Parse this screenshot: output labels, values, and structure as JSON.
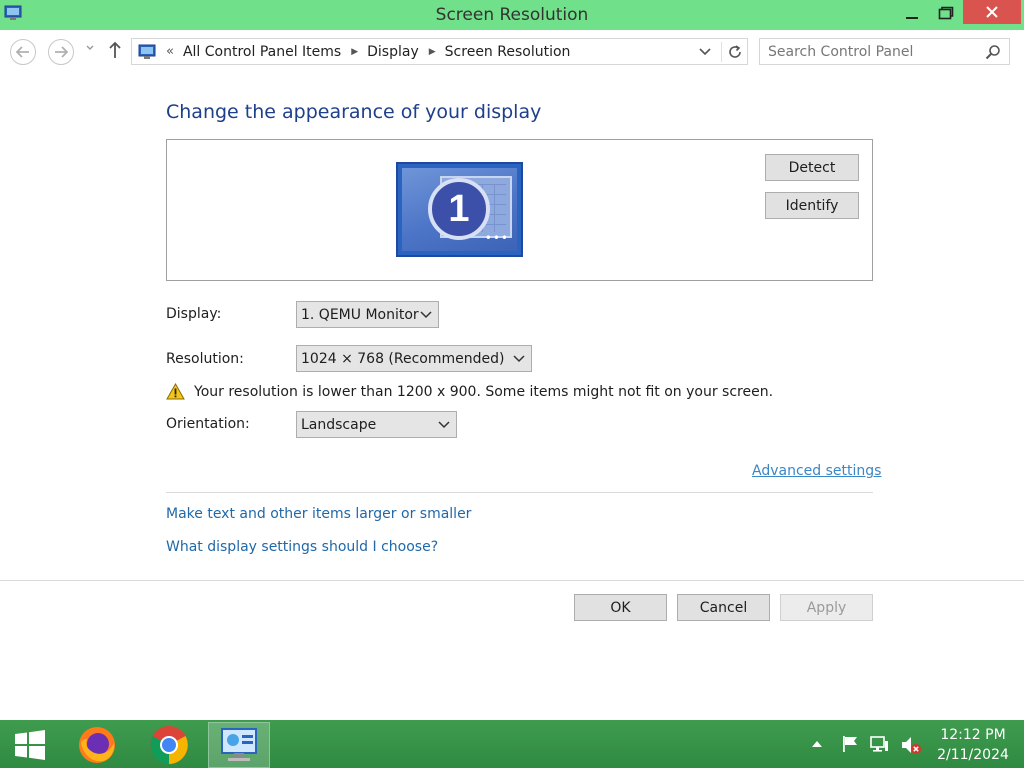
{
  "window": {
    "title": "Screen Resolution"
  },
  "address_bar": {
    "overflow": "«",
    "breadcrumbs": [
      "All Control Panel Items",
      "Display",
      "Screen Resolution"
    ],
    "search_placeholder": "Search Control Panel"
  },
  "main": {
    "heading": "Change the appearance of your display",
    "monitor_number": "1",
    "monitor_dots": "•••",
    "detect_label": "Detect",
    "identify_label": "Identify",
    "display_label": "Display:",
    "display_value": "1. QEMU Monitor",
    "resolution_label": "Resolution:",
    "resolution_value": "1024 × 768 (Recommended)",
    "warning_text": "Your resolution is lower than 1200 x 900. Some items might not fit on your screen.",
    "orientation_label": "Orientation:",
    "orientation_value": "Landscape",
    "advanced_link": "Advanced settings",
    "text_size_link": "Make text and other items larger or smaller",
    "help_link": "What display settings should I choose?"
  },
  "footer": {
    "ok_label": "OK",
    "cancel_label": "Cancel",
    "apply_label": "Apply"
  },
  "taskbar": {
    "time": "12:12 PM",
    "date": "2/11/2024"
  },
  "colors": {
    "titlebar": "#70e08a",
    "close_button": "#d9534f",
    "heading": "#1e3f8c",
    "link": "#2168a8",
    "taskbar": "#2f8a42"
  },
  "icons": [
    "control-panel-icon",
    "minimize-icon",
    "maximize-icon",
    "close-icon",
    "back-icon",
    "forward-icon",
    "recent-dropdown-icon",
    "up-icon",
    "chevron-down-icon",
    "refresh-icon",
    "search-icon",
    "warning-icon",
    "windows-start-icon",
    "firefox-icon",
    "chrome-icon",
    "tray-up-arrow-icon",
    "flag-icon",
    "network-icon",
    "volume-muted-icon"
  ]
}
